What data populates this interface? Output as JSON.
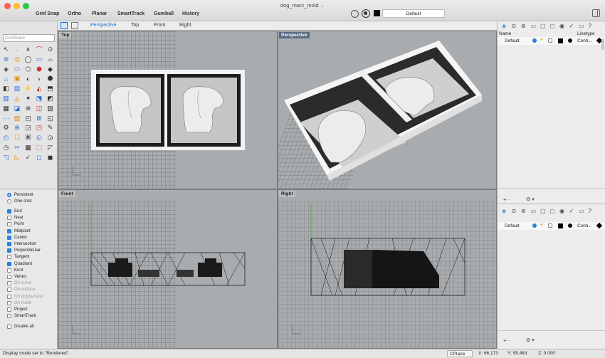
{
  "window": {
    "title": "dog_marc_mold"
  },
  "toolbar": {
    "grid_snap": "Grid Snap",
    "ortho": "Ortho",
    "planar": "Planar",
    "smarttrack": "SmartTrack",
    "gumball": "Gumball",
    "history": "History",
    "layer": "Default"
  },
  "command": {
    "placeholder": "Command"
  },
  "tabs": [
    "Perspective",
    "Top",
    "Front",
    "Right"
  ],
  "viewports": {
    "top": "Top",
    "perspective": "Perspective",
    "front": "Front",
    "right": "Right"
  },
  "osnap": {
    "persistent": "Persistent",
    "one_shot": "One shot",
    "items": [
      {
        "label": "End",
        "checked": true,
        "disabled": false
      },
      {
        "label": "Near",
        "checked": false,
        "disabled": false
      },
      {
        "label": "Point",
        "checked": false,
        "disabled": false
      },
      {
        "label": "Midpoint",
        "checked": true,
        "disabled": false
      },
      {
        "label": "Center",
        "checked": true,
        "disabled": false
      },
      {
        "label": "Intersection",
        "checked": true,
        "disabled": false
      },
      {
        "label": "Perpendicular",
        "checked": true,
        "disabled": false
      },
      {
        "label": "Tangent",
        "checked": false,
        "disabled": false
      },
      {
        "label": "Quadrant",
        "checked": true,
        "disabled": false
      },
      {
        "label": "Knot",
        "checked": false,
        "disabled": false
      },
      {
        "label": "Vertex",
        "checked": false,
        "disabled": false
      },
      {
        "label": "On curve",
        "checked": false,
        "disabled": true
      },
      {
        "label": "On surface",
        "checked": false,
        "disabled": true
      },
      {
        "label": "On polysurface",
        "checked": false,
        "disabled": true
      },
      {
        "label": "On mesh",
        "checked": false,
        "disabled": true
      },
      {
        "label": "Project",
        "checked": false,
        "disabled": false
      },
      {
        "label": "SmartTrack",
        "checked": false,
        "disabled": false
      }
    ],
    "disable_all": "Disable all"
  },
  "layers_panel": {
    "col_name": "Name",
    "col_linetype": "Linetype",
    "row_name": "Default",
    "row_linetype": "Conti..."
  },
  "layers_panel2": {
    "row_name": "Default",
    "row_linetype": "Conti..."
  },
  "status": {
    "message": "Display mode set to \"Rendered\".",
    "cplane": "CPlane",
    "x": "X: 66.173",
    "y": "Y: 95.463",
    "z": "Z: 0.000"
  },
  "colors": {
    "accent": "#2a7fe0",
    "viewport_bg": "#a8acaf",
    "active_label": "#5a6c85"
  }
}
